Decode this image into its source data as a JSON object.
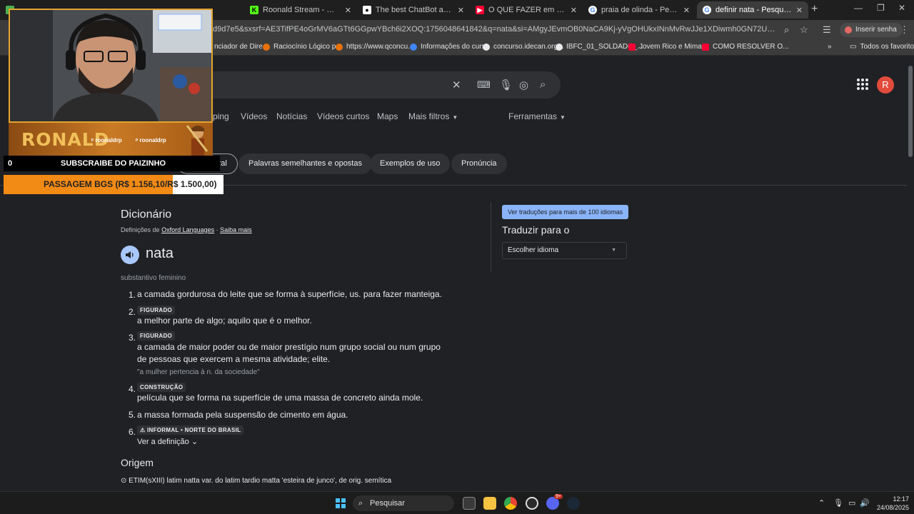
{
  "browser": {
    "tabs": [
      {
        "title": "",
        "close": "✕"
      },
      {
        "title": "Roonald Stream - Watch Live o...",
        "close": "✕"
      },
      {
        "title": "The best ChatBot and Widgets",
        "close": "✕"
      },
      {
        "title": "O QUE FAZER em CAMPINA GR...",
        "close": "✕"
      },
      {
        "title": "praia de olinda - Pesquisa Goo...",
        "close": "✕"
      },
      {
        "title": "definir nata - Pesquisa Google",
        "close": "✕"
      }
    ],
    "new_tab": "+",
    "url": "d9d7e5&sxsrf=AE3TifPE4oGrMV6aGTt6GGpwYBch6i2XOQ:1756048641842&q=nata&si=AMgyJEvmOB0NaCA9Kj-yVgOHUkxINnMvRwJJe1XDiwmh0GN72U44WI_ZHn1xYvfrVjpICF5d8ps1HuTo...",
    "insert_password": "Inserir senha",
    "bookmarks": [
      "nciador de Dire...",
      "Raciocínio Lógico p...",
      "https://www.qconcu...",
      "Informações do curso",
      "concurso.idecan.org...",
      "IBFC_01_SOLDADO_...",
      "Jovem Rico e Mima...",
      "COMO RESOLVER O..."
    ],
    "all_bookmarks": "Todos os favoritos"
  },
  "google": {
    "avatar_letter": "R",
    "nav": [
      "ping",
      "Vídeos",
      "Notícias",
      "Vídeos curtos",
      "Maps",
      "Mais filtros",
      "Ferramentas"
    ],
    "chips": [
      "Visão geral",
      "Palavras semelhantes e opostas",
      "Exemplos de uso",
      "Pronúncia"
    ]
  },
  "dictionary": {
    "title": "Dicionário",
    "source_prefix": "Definições de",
    "source_name": "Oxford Languages",
    "learn_more": "Saiba mais",
    "word": "nata",
    "part_of_speech": "substantivo feminino",
    "definitions": [
      {
        "num": "1.",
        "text": "a camada gordurosa do leite que se forma à superfície, us. para fazer manteiga."
      },
      {
        "num": "2.",
        "label": "FIGURADO",
        "text": "a melhor parte de algo; aquilo que é o melhor."
      },
      {
        "num": "3.",
        "label": "FIGURADO",
        "text": "a camada de maior poder ou de maior prestígio num grupo social ou num grupo",
        "text2": "de pessoas que exercem a mesma atividade; elite.",
        "example": "\"a mulher pertencia à n. da sociedade\""
      },
      {
        "num": "4.",
        "label": "CONSTRUÇÃO",
        "text": "película que se forma na superfície de uma massa de concreto ainda mole."
      },
      {
        "num": "5.",
        "text": "a massa formada pela suspensão de cimento em água."
      },
      {
        "num": "6.",
        "label": "⚠ INFORMAL • NORTE DO BRASIL"
      }
    ],
    "see_definition": "Ver a definição",
    "origin_title": "Origem",
    "origin_text": "⊙ ETIM(sXIII) latim natta var. do latim tardio matta 'esteira de junco', de orig. semítica"
  },
  "translate": {
    "button": "Ver traduções para mais de 100 idiomas",
    "title": "Traduzir para o",
    "select_placeholder": "Escolher idioma"
  },
  "stream_overlay": {
    "name": "RONALD",
    "handle": "roonaldrp",
    "subscriber_count": "0",
    "subscribe_label": "SUBSCRAIBE DO PAIZINHO",
    "goal_label": "PASSAGEM BGS (R$ 1.156,10/R$ 1.500,00)",
    "goal_progress": 0.7707
  },
  "taskbar": {
    "search_label": "Pesquisar",
    "time": "12:17",
    "date": "24/08/2025",
    "chat_badge": "9+"
  },
  "colors": {
    "background": "#202124",
    "accent_blue": "#8ab4f8",
    "avatar": "#e24b3c",
    "overlay_orange": "#f28a16"
  }
}
